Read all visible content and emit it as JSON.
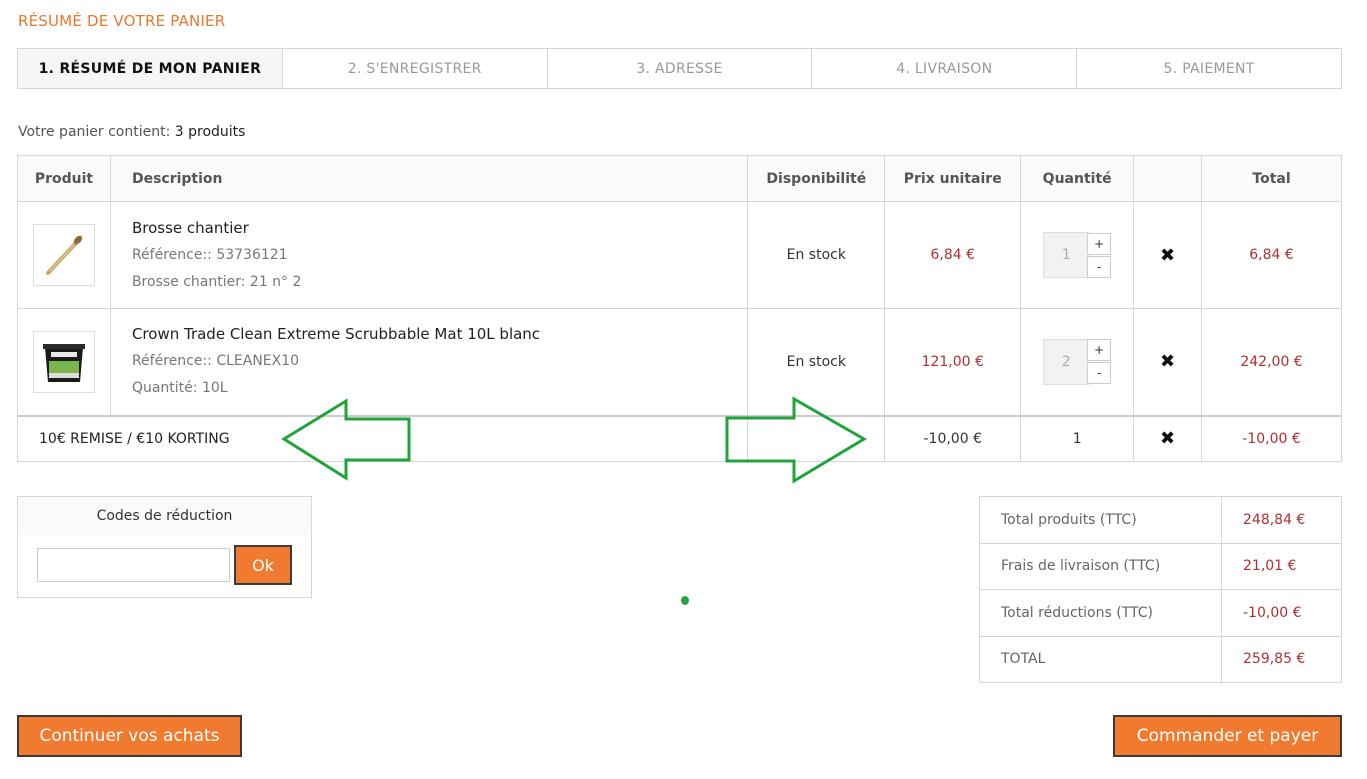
{
  "heading": "RÉSUMÉ DE VOTRE PANIER",
  "steps": [
    "1. RÉSUMÉ DE MON PANIER",
    "2. S'ENREGISTRER",
    "3. ADRESSE",
    "4. LIVRAISON",
    "5. PAIEMENT"
  ],
  "cart_count": {
    "prefix": "Votre panier contient:",
    "value": "3 produits"
  },
  "columns": [
    "Produit",
    "Description",
    "Disponibilité",
    "Prix unitaire",
    "Quantité",
    "",
    "Total"
  ],
  "items": [
    {
      "name": "Brosse chantier",
      "reference": "Référence:: 53736121",
      "attribute": "Brosse chantier: 21 n° 2",
      "availability": "En stock",
      "unit_price": "6,84 €",
      "quantity": "1",
      "total": "6,84 €",
      "image_icon": "brush-icon"
    },
    {
      "name": "Crown Trade Clean Extreme Scrubbable Mat 10L blanc",
      "reference": "Référence:: CLEANEX10",
      "attribute": "Quantité: 10L",
      "availability": "En stock",
      "unit_price": "121,00 €",
      "quantity": "2",
      "total": "242,00 €",
      "image_icon": "paint-bucket-icon"
    }
  ],
  "discount": {
    "name": "10€ REMISE / €10 KORTING",
    "unit_price": "-10,00 €",
    "quantity": "1",
    "total": "-10,00 €"
  },
  "qty_controls": {
    "plus": "+",
    "minus": "-"
  },
  "delete_icon": "✖",
  "codes": {
    "title": "Codes de réduction",
    "button": "Ok",
    "value": ""
  },
  "totals": [
    {
      "label": "Total produits (TTC)",
      "value": "248,84 €"
    },
    {
      "label": "Frais de livraison (TTC)",
      "value": "21,01 €"
    },
    {
      "label": "Total réductions (TTC)",
      "value": "-10,00 €"
    },
    {
      "label": "TOTAL",
      "value": "259,85 €"
    }
  ],
  "buttons": {
    "continue": "Continuer vos achats",
    "order": "Commander et payer"
  },
  "colors": {
    "accent": "#f07a2f",
    "price": "#b03030",
    "annotation": "#21a33b"
  }
}
